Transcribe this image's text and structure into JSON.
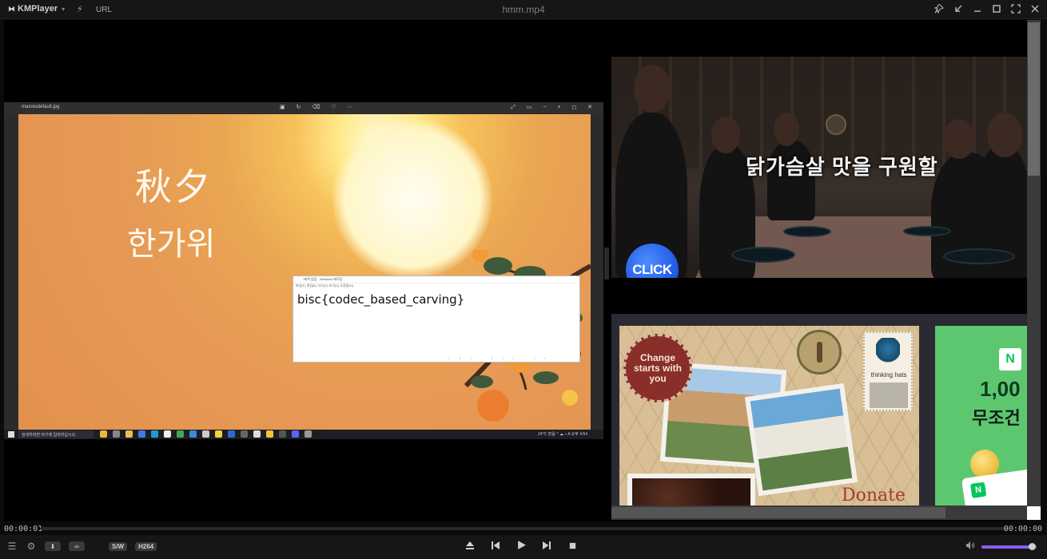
{
  "app": {
    "name": "KMPlayer",
    "url_label": "URL",
    "window_title": "hmm.mp4",
    "accent_color": "#8e5cf6"
  },
  "video": {
    "viewer": {
      "file_name": "maxresdefault.jpg",
      "hanja": "秋夕",
      "hangul": "한가위",
      "notepad_title": "*제목 없음 - Windows 메모장",
      "notepad_menu": "파일(F)  편집(E)  서식(O)  보기(V)  도움말(H)",
      "notepad_text": "bisc{codec_based_carving}",
      "taskbar_search": "검색하려면 여기에 입력하십시오.",
      "taskbar_tray": "24°C 맑음  ^  ☁  ♪  A  오후 4:54"
    },
    "ads": {
      "ad1_text": "닭가슴살 맛을 구원할",
      "click_label": "CLICK",
      "ad2_stamp": "Change starts with you",
      "ad2_postage": "thinking hats",
      "ad2_donate": "Donate",
      "ad3_logo": "N",
      "ad3_big": "1,00",
      "ad3_sub": "무조건",
      "ad3_card": "N"
    }
  },
  "playback": {
    "current_time": "00:00:01",
    "total_time": "00:00:00",
    "volume": 0.92,
    "codec_badges": [
      "S/W",
      "H264"
    ]
  },
  "icons": {
    "logo": "kmplayer-logo-icon",
    "bolt": "bolt-icon",
    "pin": "pin-icon",
    "mini": "minimode-icon",
    "minimize": "minimize-icon",
    "maximize": "maximize-icon",
    "fullscreen": "fullscreen-icon",
    "close": "close-icon",
    "playlist": "playlist-icon",
    "settings": "gear-icon",
    "capture": "capture-icon",
    "vr": "vr-icon",
    "eject": "eject-icon",
    "prev": "previous-icon",
    "play": "play-icon",
    "next": "next-icon",
    "stop": "stop-icon",
    "volume": "volume-icon"
  }
}
